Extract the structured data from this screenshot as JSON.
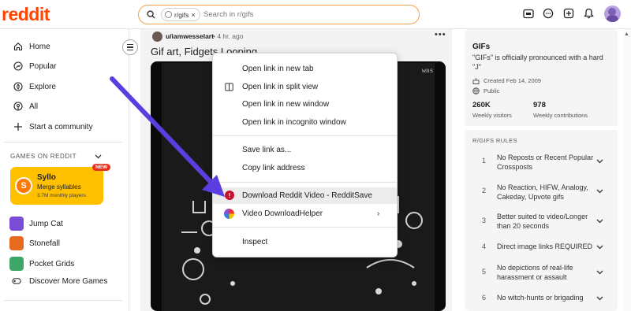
{
  "header": {
    "logo": "reddit",
    "search_chip": "r/gifs",
    "search_chip_close": "×",
    "search_placeholder": "Search in r/gifs",
    "icons": [
      "ads-icon",
      "chat-icon",
      "create-post-icon",
      "notifications-icon",
      "avatar"
    ]
  },
  "sidebar": {
    "nav": [
      {
        "label": "Home",
        "icon": "home-icon"
      },
      {
        "label": "Popular",
        "icon": "popular-icon"
      },
      {
        "label": "Explore",
        "icon": "explore-icon"
      },
      {
        "label": "All",
        "icon": "all-icon"
      },
      {
        "label": "Start a community",
        "icon": "plus-icon"
      }
    ],
    "games_label": "GAMES ON REDDIT",
    "featured_game": {
      "title": "Syllo",
      "subtitle": "Merge syllables",
      "players": "3.7M monthly players",
      "badge": "NEW",
      "logo_letter": "S"
    },
    "games": [
      {
        "label": "Jump Cat"
      },
      {
        "label": "Stonefall"
      },
      {
        "label": "Pocket Grids"
      },
      {
        "label": "Discover More Games"
      }
    ]
  },
  "post": {
    "user": "u/iamwesselart",
    "time": "• 4 hr. ago",
    "more": "•••",
    "title": "Gif art, Fidgets Looping",
    "media_corner_text": "was"
  },
  "context_menu": {
    "items": [
      {
        "label": "Open link in new tab"
      },
      {
        "label": "Open link in split view"
      },
      {
        "label": "Open link in new window"
      },
      {
        "label": "Open link in incognito window"
      },
      {
        "label": "Save link as..."
      },
      {
        "label": "Copy link address"
      },
      {
        "label": "Download Reddit Video - RedditSave"
      },
      {
        "label": "Video DownloadHelper",
        "arrow": "›"
      },
      {
        "label": "Inspect"
      }
    ]
  },
  "community": {
    "name": "GIFs",
    "description": "\"GIFs\" is officially pronounced with a hard \"J\"",
    "created": "Created Feb 14, 2009",
    "visibility": "Public",
    "stats": [
      {
        "value": "260K",
        "label": "Weekly visitors"
      },
      {
        "value": "978",
        "label": "Weekly contributions"
      }
    ],
    "rules_heading": "R/GIFS RULES",
    "rules": [
      {
        "num": "1",
        "text": "No Reposts or Recent Popular Crossposts"
      },
      {
        "num": "2",
        "text": "No Reaction, HIFW, Analogy, Cakeday, Upvote gifs"
      },
      {
        "num": "3",
        "text": "Better suited to video/Longer than 20 seconds"
      },
      {
        "num": "4",
        "text": "Direct image links REQUIRED"
      },
      {
        "num": "5",
        "text": "No depictions of real-life harassment or assault"
      },
      {
        "num": "6",
        "text": "No witch-hunts or brigading"
      }
    ]
  },
  "colors": {
    "brand": "#ff4500",
    "arrow": "#5b3de0",
    "game_card": "#ffc000"
  }
}
